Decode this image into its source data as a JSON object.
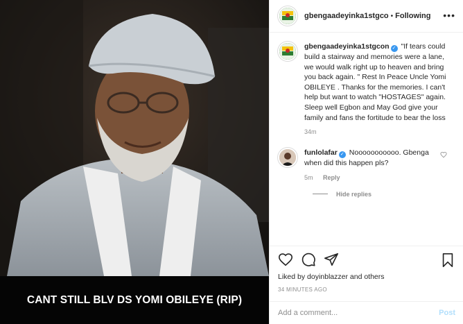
{
  "post": {
    "caption_overlay": "CANT STILL BLV DS YOMI OBILEYE (RIP)",
    "photo_icon": "portrait-photo"
  },
  "header": {
    "username": "gbengaadeyinka1stgco",
    "separator": "•",
    "follow_label": "Following",
    "more_icon": "more-options-icon"
  },
  "caption": {
    "username": "gbengaadeyinka1stgcon",
    "verified_icon": "verified-badge-icon",
    "text": "\"If tears could build a stairway and memories were a lane, we would walk right up to heaven and bring you back again. \" Rest In Peace Uncle Yomi OBILEYE . Thanks for the memories. I can't help but want to watch \"HOSTAGES\" again. Sleep well Egbon and May God give your family and fans the fortitude to bear the loss",
    "time": "34m"
  },
  "comments": [
    {
      "username": "funlolafar",
      "text": "Nooooooooooo. Gbenga when did this happen pls?",
      "time": "5m",
      "reply_label": "Reply"
    }
  ],
  "hide_replies_label": "Hide replies",
  "actions": {
    "likes_text": "Liked by doyinblazzer and others",
    "timestamp": "34 MINUTES AGO"
  },
  "add_comment": {
    "placeholder": "Add a comment...",
    "post_label": "Post"
  },
  "colors": {
    "verified": "#3897f0",
    "muted": "#8e8e8e",
    "post_disabled": "#b2dffc",
    "avatar_bg": "#2e7d32"
  }
}
